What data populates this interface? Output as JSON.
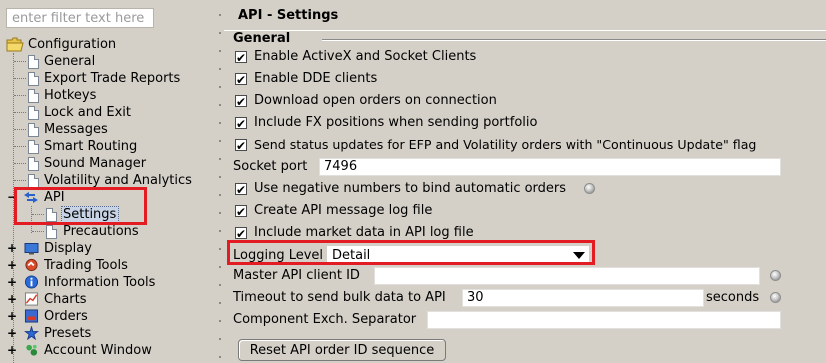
{
  "filter": {
    "placeholder": "enter filter text here"
  },
  "tree": {
    "root_label": "Configuration",
    "items": [
      {
        "label": "General"
      },
      {
        "label": "Export Trade Reports"
      },
      {
        "label": "Hotkeys"
      },
      {
        "label": "Lock and Exit"
      },
      {
        "label": "Messages"
      },
      {
        "label": "Smart Routing"
      },
      {
        "label": "Sound Manager"
      },
      {
        "label": "Volatility and Analytics"
      }
    ],
    "api": {
      "label": "API",
      "icon": "api-arrows-icon",
      "children": [
        {
          "label": "Settings"
        },
        {
          "label": "Precautions"
        }
      ]
    },
    "folders": [
      {
        "label": "Display",
        "icon": "display-icon"
      },
      {
        "label": "Trading Tools",
        "icon": "trading-tools-icon"
      },
      {
        "label": "Information Tools",
        "icon": "info-icon"
      },
      {
        "label": "Charts",
        "icon": "chart-icon"
      },
      {
        "label": "Orders",
        "icon": "orders-icon"
      },
      {
        "label": "Presets",
        "icon": "presets-icon"
      },
      {
        "label": "Account Window",
        "icon": "account-window-icon"
      }
    ]
  },
  "page": {
    "title": "API - Settings",
    "section_title": "General"
  },
  "settings": {
    "checkboxes_top": [
      {
        "label": "Enable ActiveX and Socket Clients",
        "checked": true
      },
      {
        "label": "Enable DDE clients",
        "checked": true
      },
      {
        "label": "Download open orders on connection",
        "checked": true
      },
      {
        "label": "Include FX positions when sending portfolio",
        "checked": true
      },
      {
        "label": "Send status updates for EFP and Volatility orders with \"Continuous Update\" flag",
        "checked": true
      }
    ],
    "socket_port": {
      "label": "Socket port",
      "value": "7496"
    },
    "checkboxes_bottom": [
      {
        "label": "Use negative numbers to bind automatic orders",
        "checked": true
      },
      {
        "label": "Create API message log file",
        "checked": true
      },
      {
        "label": "Include market data in API log file",
        "checked": true
      }
    ],
    "logging_level": {
      "label": "Logging Level",
      "value": "Detail"
    },
    "master_client_id": {
      "label": "Master API client ID",
      "value": ""
    },
    "timeout": {
      "label": "Timeout to send bulk data to API",
      "value": "30",
      "unit": "seconds"
    },
    "component_separator": {
      "label": "Component Exch. Separator",
      "value": ""
    },
    "reset_button_label": "Reset API order ID sequence"
  },
  "colors": {
    "highlight_red": "#e31b23",
    "selection_bg": "#c8d4e6",
    "panel_bg": "#d4d0c8"
  }
}
